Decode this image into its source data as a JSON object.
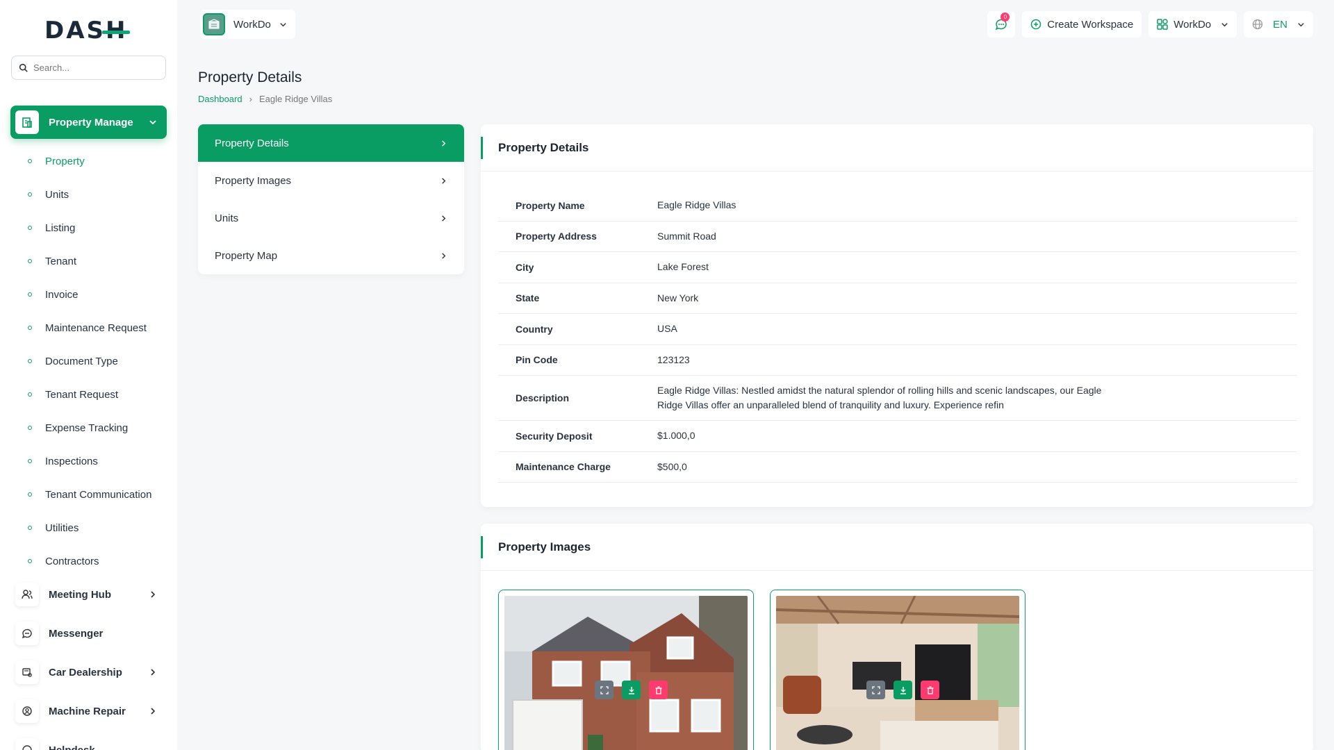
{
  "brand": {
    "logo_text": "DASH"
  },
  "search": {
    "placeholder": "Search..."
  },
  "sidebar": {
    "active_group": "Property Manage",
    "sub_items": [
      "Property",
      "Units",
      "Listing",
      "Tenant",
      "Invoice",
      "Maintenance Request",
      "Document Type",
      "Tenant Request",
      "Expense Tracking",
      "Inspections",
      "Tenant Communication",
      "Utilities",
      "Contractors"
    ],
    "groups": [
      {
        "label": "Meeting Hub",
        "icon": "users-icon",
        "has_children": true
      },
      {
        "label": "Messenger",
        "icon": "chat-icon",
        "has_children": false
      },
      {
        "label": "Car Dealership",
        "icon": "car-icon",
        "has_children": true
      },
      {
        "label": "Machine Repair",
        "icon": "repair-icon",
        "has_children": true
      },
      {
        "label": "Helpdesk",
        "icon": "helpdesk-icon",
        "has_children": false
      }
    ]
  },
  "header": {
    "workspace": "WorkDo",
    "messages_count": "0",
    "create_workspace": "Create Workspace",
    "workspace_menu": "WorkDo",
    "language": "EN"
  },
  "page": {
    "title": "Property Details",
    "breadcrumb": {
      "home": "Dashboard",
      "current": "Eagle Ridge Villas"
    }
  },
  "tabs": [
    "Property Details",
    "Property Images",
    "Units",
    "Property Map"
  ],
  "details": {
    "title": "Property Details",
    "rows": [
      {
        "label": "Property Name",
        "value": "Eagle Ridge Villas"
      },
      {
        "label": "Property Address",
        "value": "Summit Road"
      },
      {
        "label": "City",
        "value": "Lake Forest"
      },
      {
        "label": "State",
        "value": "New York"
      },
      {
        "label": "Country",
        "value": "USA"
      },
      {
        "label": "Pin Code",
        "value": "123123"
      },
      {
        "label": "Description",
        "value": "Eagle Ridge Villas: Nestled amidst the natural splendor of rolling hills and scenic landscapes, our Eagle Ridge Villas offer an unparalleled blend of tranquility and luxury. Experience refin"
      },
      {
        "label": "Security Deposit",
        "value": "$1.000,0"
      },
      {
        "label": "Maintenance Charge",
        "value": "$500,0"
      }
    ]
  },
  "images": {
    "title": "Property Images"
  },
  "colors": {
    "accent": "#0a9d63",
    "danger": "#ff3a6e",
    "muted": "#6c757d"
  }
}
